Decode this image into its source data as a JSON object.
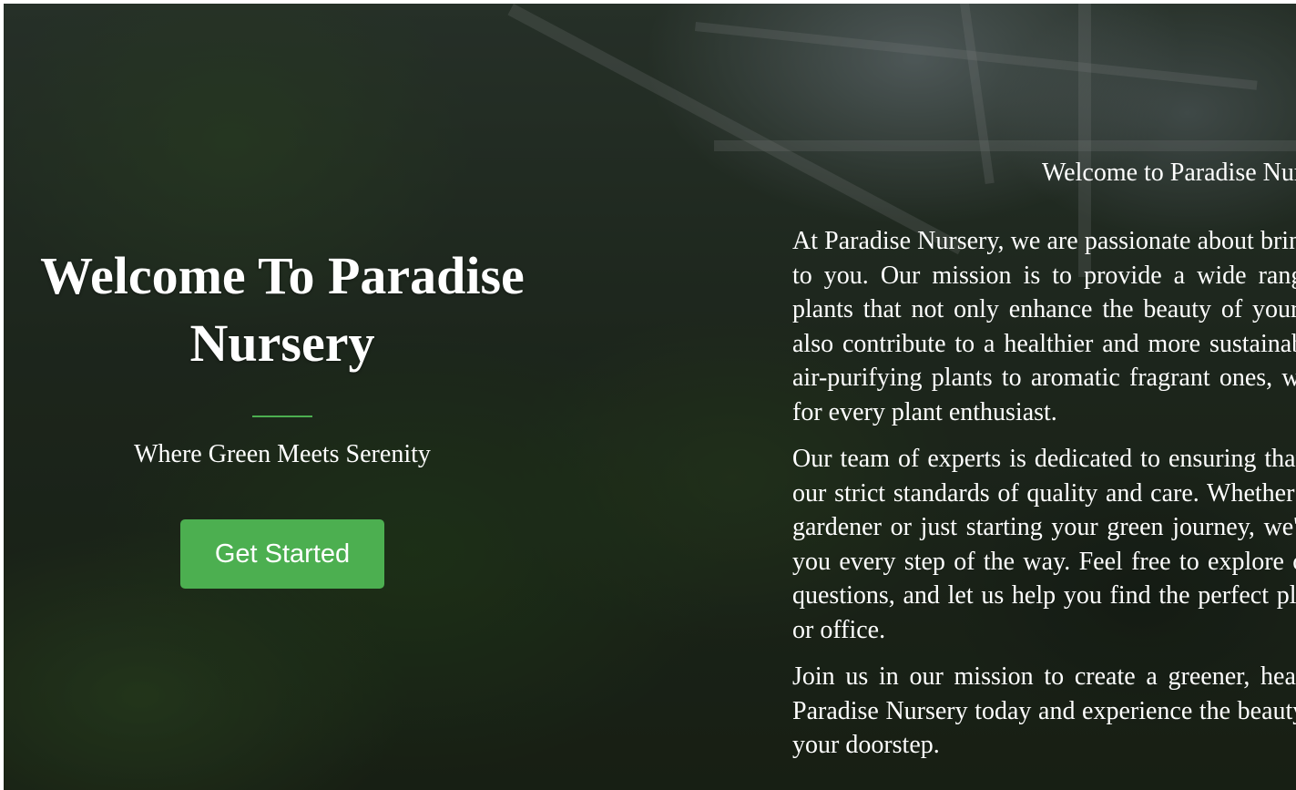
{
  "hero": {
    "title": "Welcome To Paradise Nursery",
    "tagline": "Where Green Meets Serenity",
    "cta_label": "Get Started"
  },
  "about": {
    "heading": "Welcome to Paradise Nursery, where green meets serenity!",
    "paragraphs": [
      "At Paradise Nursery, we are passionate about bringing nature closer to you. Our mission is to provide a wide range of high-quality plants that not only enhance the beauty of your surroundings but also contribute to a healthier and more sustainable lifestyle. From air-purifying plants to aromatic fragrant ones, we have something for every plant enthusiast.",
      "Our team of experts is dedicated to ensuring that each plant meets our strict standards of quality and care. Whether you're a seasoned gardener or just starting your green journey, we're here to support you every step of the way. Feel free to explore our collection, ask questions, and let us help you find the perfect plant for your home or office.",
      "Join us in our mission to create a greener, healthier world. Visit Paradise Nursery today and experience the beauty of nature right at your doorstep."
    ]
  },
  "colors": {
    "accent": "#4caf50",
    "text": "#ffffff"
  }
}
